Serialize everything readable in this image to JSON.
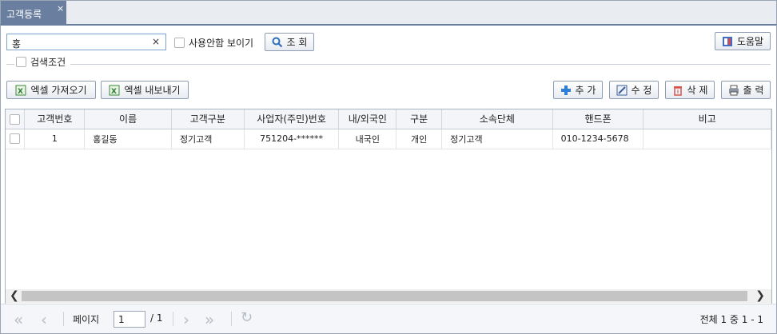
{
  "tab": {
    "title": "고객등록",
    "close": "×"
  },
  "search": {
    "value": "홍",
    "clear": "×"
  },
  "show_inactive_label": "사용안함 보이기",
  "query_button": "조 회",
  "help_button": "도움말",
  "conditions_label": "검색조건",
  "toolbar": {
    "excel_import": "엑셀 가져오기",
    "excel_export": "엑셀 내보내기",
    "add": "추 가",
    "edit": "수 정",
    "delete": "삭 제",
    "print": "출 력"
  },
  "table": {
    "headers": [
      "고객번호",
      "이름",
      "고객구분",
      "사업자(주민)번호",
      "내/외국인",
      "구분",
      "소속단체",
      "핸드폰",
      "비고"
    ],
    "rows": [
      [
        "1",
        "홍길동",
        "정기고객",
        "751204-******",
        "내국인",
        "개인",
        "정기고객",
        "010-1234-5678",
        ""
      ]
    ]
  },
  "pager": {
    "page_label": "페이지",
    "page_value": "1",
    "total_pages": "/ 1",
    "summary": "전체 1 중 1 - 1"
  },
  "colors": {
    "tab_active": "#6a7fa0",
    "accent_blue": "#2f7fd6"
  },
  "icons": {
    "search_icon": "magnifier",
    "help_icon": "book",
    "excel_icon": "excel",
    "add_icon": "plus",
    "edit_icon": "pencil",
    "delete_icon": "trash",
    "print_icon": "printer",
    "refresh_icon": "refresh"
  }
}
